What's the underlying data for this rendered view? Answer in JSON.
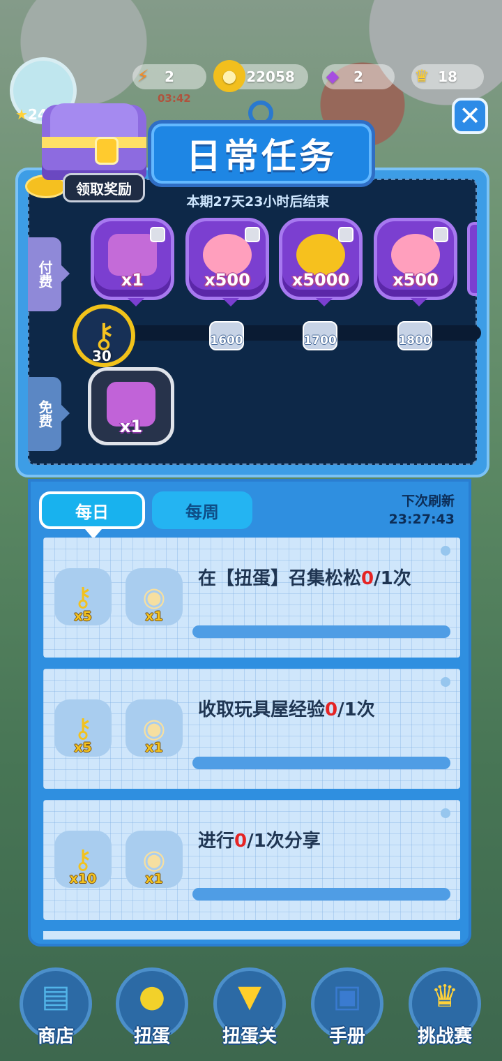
{
  "resources": {
    "energy": "2",
    "energy_timer": "03:42",
    "coins": "22058",
    "gems": "2",
    "crowns": "18"
  },
  "player": {
    "level_prefix": "24"
  },
  "title": "日常任务",
  "chest_button": "领取奖励",
  "period_text": "本期27天23小时后结束",
  "side_tabs": {
    "paid": "付费",
    "free": "免费"
  },
  "paid_rewards": [
    {
      "icon": "gift-box-icon",
      "qty": "x1"
    },
    {
      "icon": "heart-icon",
      "qty": "x500"
    },
    {
      "icon": "coin-icon",
      "qty": "x5000"
    },
    {
      "icon": "heart-icon",
      "qty": "x500"
    }
  ],
  "key_count": "30",
  "milestones": [
    "1600",
    "1700",
    "1800"
  ],
  "free_reward": {
    "icon": "gift-box-icon",
    "qty": "x1"
  },
  "tabs": {
    "daily": "每日",
    "weekly": "每周"
  },
  "refresh": {
    "label": "下次刷新",
    "time": "23:27:43"
  },
  "tasks": [
    {
      "desc_prefix": "在【扭蛋】召集松松",
      "current": "0",
      "desc_suffix": "/1次",
      "rewards": [
        {
          "icon": "key-icon",
          "qty": "x5"
        },
        {
          "icon": "cake-icon",
          "qty": "x1"
        }
      ],
      "progress": 0
    },
    {
      "desc_prefix": "收取玩具屋经验",
      "current": "0",
      "desc_suffix": "/1次",
      "rewards": [
        {
          "icon": "key-icon",
          "qty": "x5"
        },
        {
          "icon": "cake-icon",
          "qty": "x1"
        }
      ],
      "progress": 0
    },
    {
      "desc_prefix": "进行",
      "current": "0",
      "desc_suffix": "/1次分享",
      "rewards": [
        {
          "icon": "key-icon",
          "qty": "x10"
        },
        {
          "icon": "cake-icon",
          "qty": "x1"
        }
      ],
      "progress": 0
    }
  ],
  "nav": [
    "商店",
    "扭蛋",
    "扭蛋关",
    "手册",
    "挑战赛"
  ],
  "colors": {
    "accent": "#2f8fe0",
    "highlight": "#e52424",
    "gold": "#f5c320"
  }
}
